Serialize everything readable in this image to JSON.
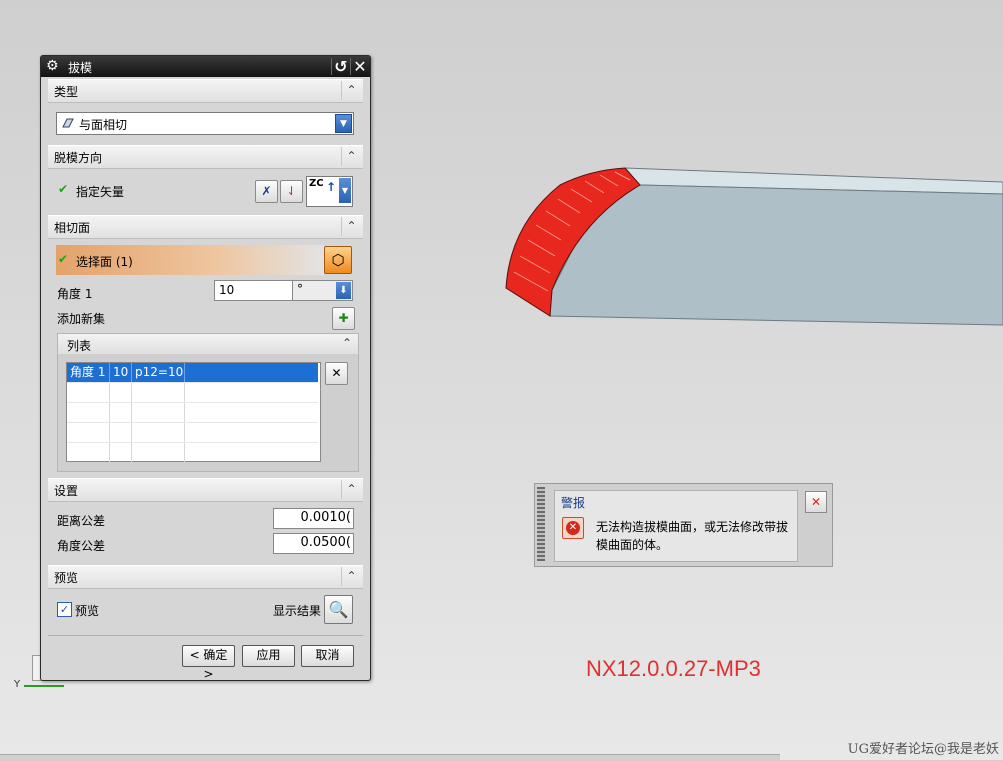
{
  "dialog": {
    "title": "拔模",
    "sections": {
      "type": {
        "label": "类型",
        "selected": "与面相切",
        "icons": [
          "draft-type-icon"
        ]
      },
      "direction": {
        "label": "脱模方向",
        "specify_vector": "指定矢量",
        "vector_value": "ZC"
      },
      "tangent_face": {
        "label": "相切面",
        "select_face": "选择面 (1)",
        "angle_label": "角度 1",
        "angle_value": "10",
        "angle_unit": "°",
        "add_set": "添加新集",
        "list": {
          "label": "列表",
          "rows": [
            [
              "角度 1",
              "10",
              "p12=10",
              ""
            ],
            [
              "",
              "",
              "",
              ""
            ],
            [
              "",
              "",
              "",
              ""
            ],
            [
              "",
              "",
              "",
              ""
            ],
            [
              "",
              "",
              "",
              ""
            ]
          ]
        }
      },
      "settings": {
        "label": "设置",
        "distance_tol_label": "距离公差",
        "distance_tol_value": "0.0010(",
        "angle_tol_label": "角度公差",
        "angle_tol_value": "0.0500("
      },
      "preview": {
        "label": "预览",
        "preview_check": "预览",
        "preview_checked": true,
        "show_result": "显示结果"
      }
    },
    "buttons": {
      "ok": "< 确定 >",
      "apply": "应用",
      "cancel": "取消"
    }
  },
  "warning": {
    "title": "警报",
    "message": "无法构造拔模曲面，或无法修改带拔模曲面的体。"
  },
  "axis": {
    "y_label": "Y"
  },
  "version_label": "NX12.0.0.27-MP3",
  "watermark": "UG爱好者论坛@我是老妖",
  "colors": {
    "accent_blue": "#1e6fd3",
    "draft_face_red": "#e8281e",
    "body_blue_gray": "#aebfc7",
    "select_orange": "#e4a26a",
    "version_red": "#e03030"
  }
}
